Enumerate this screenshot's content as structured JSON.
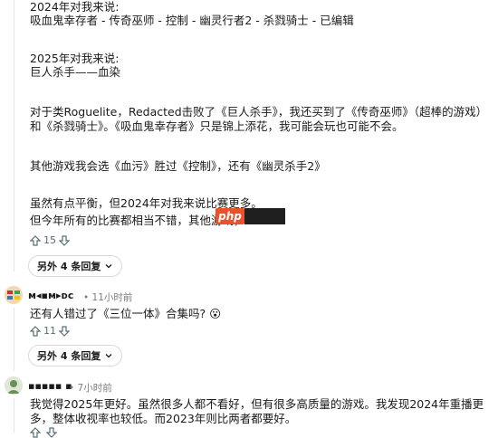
{
  "post": {
    "line_2024_header": "2024年对我来说:",
    "line_2024_list": "吸血鬼幸存者 - 传奇巫师 - 控制 - 幽灵行者2 - 杀戮骑士 - 已编辑",
    "line_2025_header": "2025年对我来说:",
    "line_2025_item": "巨人杀手——血染",
    "para_roguelite": "对于类Roguelite，Redacted击败了《巨人杀手》，我还买到了《传奇巫师》（超棒的游戏）和《杀戮骑士》。《吸血鬼幸存者》只是锦上添花，我可能会玩也可能不会。",
    "para_other": "其他游戏我会选《血污》胜过《控制》，还有《幽灵杀手2》",
    "para_balance": "虽然有点平衡，但2024年对我来说比赛更多。",
    "para_this_year": "但今年所有的比赛都相当不错，其他游戏，",
    "php_badge": "php",
    "votes": "15",
    "more_replies": "另外 4 条回复"
  },
  "comment1": {
    "username": "ᴍ◂▪ᴍ▸ᴅᴄ",
    "timestamp": "• 11小时前",
    "text": "还有人错过了《三位一体》合集吗?",
    "emoji": "😮",
    "votes": "11",
    "more_replies": "另外 4 条回复"
  },
  "comment2": {
    "username": "▪▪▪▪▪ ▪",
    "timestamp": "• 7小时前",
    "text": "我觉得2025年更好。虽然很多人都不看好，但有很多高质量的游戏。我发现2024年重播更多，整体收视率也较低。而2023年则比两者都要好。",
    "votes": ""
  },
  "colors": {
    "accent": "#e8532d",
    "muted": "#576f76",
    "border": "#d7dadc"
  },
  "icons": [
    "upvote-icon",
    "downvote-icon",
    "chevron-down-icon",
    "avatar-icon"
  ]
}
